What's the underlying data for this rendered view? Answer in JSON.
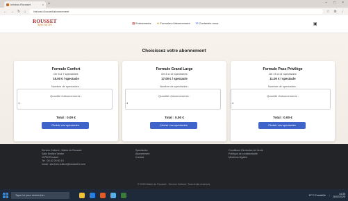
{
  "browser": {
    "tab_title": "Infobus Rousset",
    "new_tab": "+",
    "tab_close": "×",
    "url": "hlshost:/Accueil/abonnement",
    "window_controls": [
      "–",
      "□",
      "×"
    ],
    "toolbar_icons": [
      "☆",
      "⚙",
      "⋮"
    ]
  },
  "site": {
    "logo_line1": "ROUSSET",
    "logo_line2": "Spectacles",
    "menu": [
      {
        "label": "Evénements",
        "icon": "calendar-icon"
      },
      {
        "label": "Formules d'abonnement",
        "icon": "star-icon"
      },
      {
        "label": "Contactez-nous",
        "icon": "mail-icon"
      }
    ],
    "account_icon": "user-icon"
  },
  "page_title": "Choisissez votre abonnement",
  "cards": [
    {
      "name": "Formule Confort",
      "range": "De 5 à 7 spectacles",
      "price": "15.00 € / spectacle",
      "n_label": "Nombre de spectacles :",
      "q_label": "Quantité d'abonnements :",
      "q_value": "1",
      "total": "Total : 0.00 €",
      "button": "Choisir vos spectacles"
    },
    {
      "name": "Formule Grand Large",
      "range": "De 8 à 14 spectacles",
      "price": "17.00 € / spectacle",
      "n_label": "Nombre de spectacles :",
      "q_label": "Quantité d'abonnements :",
      "q_value": "1",
      "total": "Total : 0.00 €",
      "button": "Choisir vos spectacles"
    },
    {
      "name": "Formule Pass Privilège",
      "range": "De 15 à 21 spectacles",
      "price": "11.00 € / spectacle",
      "n_label": "Nombre de spectacles :",
      "q_label": "Quantité d'abonnements :",
      "q_value": "1",
      "total": "Total : 0.00 €",
      "button": "Choisir vos spectacles"
    }
  ],
  "footer": {
    "col1": [
      "Service Culturel - Mairie de Rousset",
      "Salle Emilien Ventre",
      "13790 Rousset",
      "Tel : 04 42 29 00 10",
      "email : services.culture@rousset-fr.com"
    ],
    "col2": [
      "Spectacles",
      "Abonnement",
      "Contact"
    ],
    "col3": [
      "Conditions Générales de Vente",
      "Politique de confidentialité",
      "Mentions légales"
    ],
    "copyright": "© 2025 Mairie de Rousset - Service Culturel. Tous droits réservés."
  },
  "taskbar": {
    "search_placeholder": "Taper ici pour rechercher",
    "weather": "12°C Ensoleillé",
    "time": "14:35",
    "date": "26/02/2025"
  },
  "colors": {
    "button": "#3e63c9",
    "footer_bg": "#222428",
    "page_bg": "#f4eee8"
  }
}
